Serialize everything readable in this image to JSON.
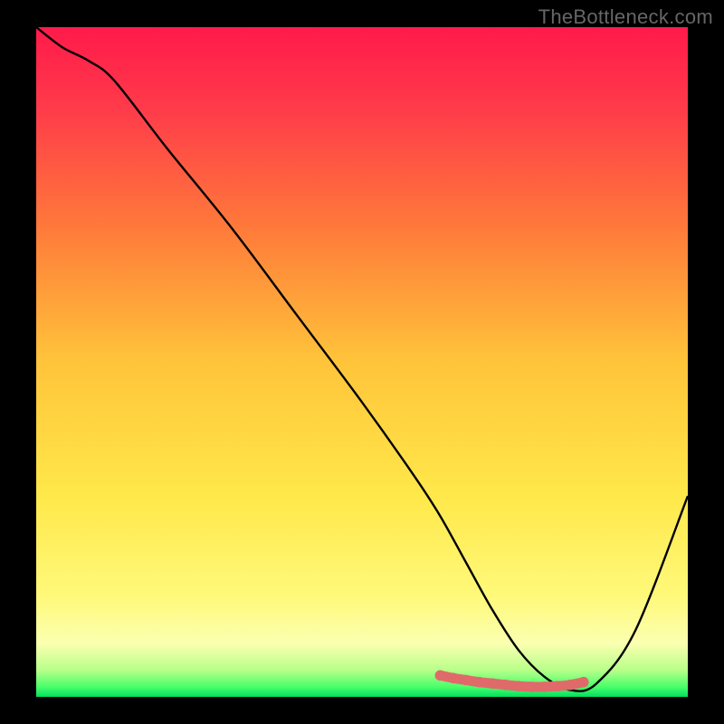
{
  "watermark": "TheBottleneck.com",
  "chart_data": {
    "type": "line",
    "title": "",
    "xlabel": "",
    "ylabel": "",
    "xlim": [
      0,
      100
    ],
    "ylim": [
      0,
      100
    ],
    "background_gradient": {
      "stops": [
        {
          "offset": 0.0,
          "color": "#ff1a4a"
        },
        {
          "offset": 0.12,
          "color": "#ff3a4a"
        },
        {
          "offset": 0.3,
          "color": "#ff7a3a"
        },
        {
          "offset": 0.5,
          "color": "#ffc43a"
        },
        {
          "offset": 0.7,
          "color": "#ffe84a"
        },
        {
          "offset": 0.85,
          "color": "#fff97a"
        },
        {
          "offset": 0.92,
          "color": "#fbffb0"
        },
        {
          "offset": 0.96,
          "color": "#b8ff8a"
        },
        {
          "offset": 0.985,
          "color": "#4aff6a"
        },
        {
          "offset": 1.0,
          "color": "#00e060"
        }
      ]
    },
    "series": [
      {
        "name": "bottleneck-curve",
        "color": "#000000",
        "x": [
          0,
          4,
          8,
          12,
          20,
          30,
          40,
          50,
          58,
          62,
          66,
          70,
          74,
          78,
          82,
          86,
          92,
          100
        ],
        "values": [
          100,
          97,
          95,
          92,
          82,
          70,
          57,
          44,
          33,
          27,
          20,
          13,
          7,
          3,
          1,
          2,
          10,
          30
        ]
      }
    ],
    "highlight_segment": {
      "name": "optimal-range",
      "color": "#e06a6a",
      "x": [
        62,
        64,
        66,
        68,
        70,
        72,
        74,
        76,
        78,
        80,
        82,
        84
      ],
      "values": [
        3.2,
        2.8,
        2.5,
        2.2,
        2.0,
        1.8,
        1.6,
        1.5,
        1.5,
        1.6,
        1.8,
        2.2
      ]
    }
  }
}
